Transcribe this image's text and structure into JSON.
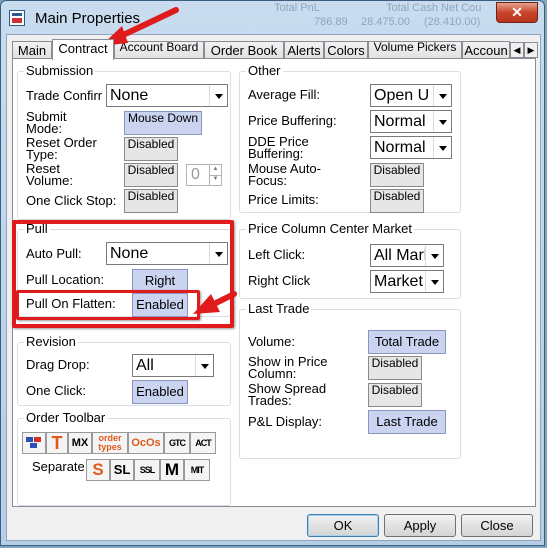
{
  "window": {
    "title": "Main Properties",
    "close_glyph": "✕"
  },
  "background_strip": [
    "Total PnL",
    "Total Cash Net Cou",
    "786.89",
    "28.475.00",
    "(28.410.00)"
  ],
  "tabs": [
    {
      "label": "Main",
      "active": false
    },
    {
      "label": "Contract",
      "active": true
    },
    {
      "label": "Account Board",
      "active": false
    },
    {
      "label": "Order Book",
      "active": false
    },
    {
      "label": "Alerts",
      "active": false
    },
    {
      "label": "Colors",
      "active": false
    },
    {
      "label": "Volume Pickers",
      "active": false
    },
    {
      "label": "Accoun",
      "active": false
    }
  ],
  "tab_scroll": {
    "left": "◀",
    "right": "▶"
  },
  "submission": {
    "legend": "Submission",
    "trade_confirm": {
      "label": "Trade Confirm",
      "value": "None"
    },
    "submit_mode": {
      "label": "Submit Mode:",
      "value": "Mouse Down"
    },
    "reset_order_type": {
      "label": "Reset Order Type:",
      "value": "Disabled"
    },
    "reset_volume": {
      "label": "Reset Volume:",
      "value": "Disabled",
      "spin": "0"
    },
    "one_click_stop": {
      "label": "One Click Stop:",
      "value": "Disabled"
    }
  },
  "pull": {
    "legend": "Pull",
    "auto_pull": {
      "label": "Auto Pull:",
      "value": "None"
    },
    "pull_location": {
      "label": "Pull Location:",
      "value": "Right"
    },
    "pull_on_flatten": {
      "label": "Pull On Flatten:",
      "value": "Enabled"
    }
  },
  "revision": {
    "legend": "Revision",
    "drag_drop": {
      "label": "Drag Drop:",
      "value": "All"
    },
    "one_click": {
      "label": "One Click:",
      "value": "Enabled"
    }
  },
  "order_toolbar": {
    "legend": "Order Toolbar",
    "separate_label": "Separate",
    "row1": [
      {
        "name": "buy-sell-icon",
        "text": ""
      },
      {
        "name": "t-icon",
        "text": "T"
      },
      {
        "name": "mx-icon",
        "text": "MX"
      },
      {
        "name": "order-types-icon",
        "text": "order types"
      },
      {
        "name": "ocos-icon",
        "text": "OcOs"
      },
      {
        "name": "gtc-icon",
        "text": "GTC"
      },
      {
        "name": "act-icon",
        "text": "ACT"
      }
    ],
    "row2": [
      {
        "name": "s-icon",
        "text": "S"
      },
      {
        "name": "sl-icon",
        "text": "SL"
      },
      {
        "name": "ssl-icon",
        "text": "SSL"
      },
      {
        "name": "m-icon",
        "text": "M"
      },
      {
        "name": "mit-icon",
        "text": "MIT"
      }
    ]
  },
  "other": {
    "legend": "Other",
    "average_fill": {
      "label": "Average Fill:",
      "value": "Open U"
    },
    "price_buffering": {
      "label": "Price Buffering:",
      "value": "Normal"
    },
    "dde_price_buffering": {
      "label": "DDE Price Buffering:",
      "value": "Normal"
    },
    "mouse_auto_focus": {
      "label": "Mouse Auto-Focus:",
      "value": "Disabled"
    },
    "price_limits": {
      "label": "Price Limits:",
      "value": "Disabled"
    }
  },
  "price_column": {
    "legend": "Price Column Center Market",
    "left_click": {
      "label": "Left Click:",
      "value": "All Mark"
    },
    "right_click": {
      "label": "Right Click",
      "value": "Market"
    }
  },
  "last_trade": {
    "legend": "Last Trade",
    "volume": {
      "label": "Volume:",
      "value": "Total Trade"
    },
    "show_in_price_column": {
      "label": "Show in Price Column:",
      "value": "Disabled"
    },
    "show_spread_trades": {
      "label": "Show Spread Trades:",
      "value": "Disabled"
    },
    "pl_display": {
      "label": "P&L Display:",
      "value": "Last Trade"
    }
  },
  "buttons": {
    "ok": "OK",
    "apply": "Apply",
    "close": "Close"
  },
  "colors": {
    "annotation": "#e01b1b",
    "selected_button": "#cad3ef",
    "close_button": "#c9452b"
  }
}
